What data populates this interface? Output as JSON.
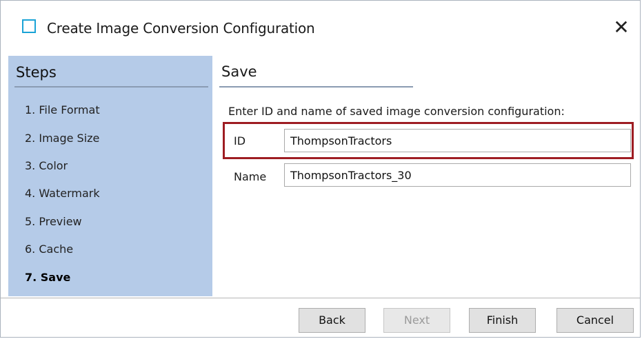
{
  "window": {
    "title": "Create Image Conversion Configuration",
    "close_glyph": "✕"
  },
  "sidebar": {
    "heading": "Steps",
    "steps": [
      {
        "label": "1. File Format"
      },
      {
        "label": "2. Image Size"
      },
      {
        "label": "3. Color"
      },
      {
        "label": "4. Watermark"
      },
      {
        "label": "5. Preview"
      },
      {
        "label": "6. Cache"
      },
      {
        "label": "7. Save",
        "current": true
      }
    ]
  },
  "main": {
    "heading": "Save",
    "instruction": "Enter ID and name of saved image conversion configuration:",
    "id_field": {
      "label": "ID",
      "value": "ThompsonTractors"
    },
    "name_field": {
      "label": "Name",
      "value": "ThompsonTractors_30"
    }
  },
  "footer": {
    "back_label": "Back",
    "next_label": "Next",
    "next_disabled": true,
    "finish_label": "Finish",
    "cancel_label": "Cancel"
  },
  "colors": {
    "sidebar_background": "#b5cbe8",
    "highlight_border": "#9e1c22",
    "app_icon": "#1aa3d6"
  }
}
